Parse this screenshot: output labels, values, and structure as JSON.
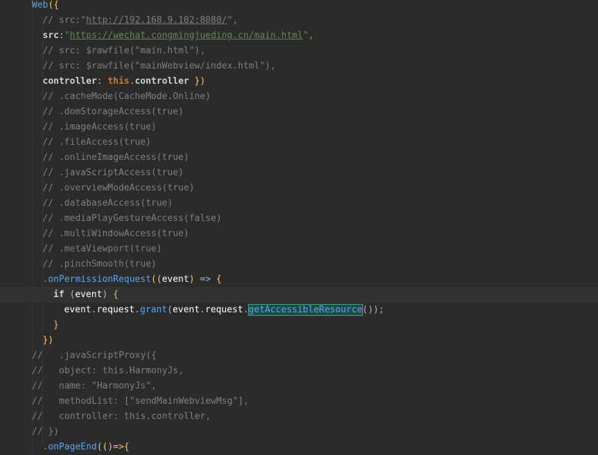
{
  "editor": {
    "lines": [
      {
        "indent": 0,
        "tokens": [
          {
            "t": "Web",
            "c": "f"
          },
          {
            "t": "({",
            "c": "y"
          }
        ]
      },
      {
        "indent": 1,
        "tokens": [
          {
            "t": "// src:\"",
            "c": "c"
          },
          {
            "t": "http://192.168.9.102:8080/",
            "c": "cu"
          },
          {
            "t": "\",",
            "c": "c"
          }
        ]
      },
      {
        "indent": 1,
        "tokens": [
          {
            "t": "src",
            "c": "w"
          },
          {
            "t": ":",
            "c": "p"
          },
          {
            "t": "\"",
            "c": "s"
          },
          {
            "t": "https://wechat.congmingjueding.cn/main.html",
            "c": "su"
          },
          {
            "t": "\"",
            "c": "s"
          },
          {
            "t": ",",
            "c": "k"
          }
        ]
      },
      {
        "indent": 1,
        "tokens": [
          {
            "t": "// src: $rawfile(\"main.html\"),",
            "c": "c"
          }
        ]
      },
      {
        "indent": 1,
        "tokens": [
          {
            "t": "// src: $rawfile(\"mainWebview/index.html\"),",
            "c": "c"
          }
        ]
      },
      {
        "indent": 1,
        "tokens": [
          {
            "t": "controller",
            "c": "w"
          },
          {
            "t": ": ",
            "c": "p"
          },
          {
            "t": "this",
            "c": "th"
          },
          {
            "t": ".",
            "c": "p"
          },
          {
            "t": "controller",
            "c": "w"
          },
          {
            "t": " })",
            "c": "y"
          }
        ]
      },
      {
        "indent": 1,
        "tokens": [
          {
            "t": "// .cacheMode(CacheMode.Online)",
            "c": "c"
          }
        ]
      },
      {
        "indent": 1,
        "tokens": [
          {
            "t": "// .domStorageAccess(true)",
            "c": "c"
          }
        ]
      },
      {
        "indent": 1,
        "tokens": [
          {
            "t": "// .imageAccess(true)",
            "c": "c"
          }
        ]
      },
      {
        "indent": 1,
        "tokens": [
          {
            "t": "// .fileAccess(true)",
            "c": "c"
          }
        ]
      },
      {
        "indent": 1,
        "tokens": [
          {
            "t": "// .onlineImageAccess(true)",
            "c": "c"
          }
        ]
      },
      {
        "indent": 1,
        "tokens": [
          {
            "t": "// .javaScriptAccess(true)",
            "c": "c"
          }
        ]
      },
      {
        "indent": 1,
        "tokens": [
          {
            "t": "// .overviewModeAccess(true)",
            "c": "c"
          }
        ]
      },
      {
        "indent": 1,
        "tokens": [
          {
            "t": "// .databaseAccess(true)",
            "c": "c"
          }
        ]
      },
      {
        "indent": 1,
        "tokens": [
          {
            "t": "// .mediaPlayGestureAccess(false)",
            "c": "c"
          }
        ]
      },
      {
        "indent": 1,
        "tokens": [
          {
            "t": "// .multiWindowAccess(true)",
            "c": "c"
          }
        ]
      },
      {
        "indent": 1,
        "tokens": [
          {
            "t": "// .metaViewport(true)",
            "c": "c"
          }
        ]
      },
      {
        "indent": 1,
        "tokens": [
          {
            "t": "// .pinchSmooth(true)",
            "c": "c"
          }
        ]
      },
      {
        "indent": 1,
        "tokens": [
          {
            "t": ".",
            "c": "k"
          },
          {
            "t": "onPermissionRequest",
            "c": "m"
          },
          {
            "t": "((",
            "c": "y"
          },
          {
            "t": "event",
            "c": "pl"
          },
          {
            "t": ") ",
            "c": "y"
          },
          {
            "t": "=> ",
            "c": "p"
          },
          {
            "t": "{",
            "c": "y"
          }
        ]
      },
      {
        "indent": 2,
        "current": true,
        "tokens": [
          {
            "t": "if",
            "c": "w"
          },
          {
            "t": " (",
            "c": "p"
          },
          {
            "t": "event",
            "c": "pl"
          },
          {
            "t": ") ",
            "c": "p"
          },
          {
            "t": "{",
            "c": "bk"
          }
        ]
      },
      {
        "indent": 3,
        "tokens": [
          {
            "t": "event",
            "c": "pl"
          },
          {
            "t": ".",
            "c": "p"
          },
          {
            "t": "request",
            "c": "pl"
          },
          {
            "t": ".",
            "c": "p"
          },
          {
            "t": "grant",
            "c": "m"
          },
          {
            "t": "(",
            "c": "p"
          },
          {
            "t": "event",
            "c": "pl"
          },
          {
            "t": ".",
            "c": "p"
          },
          {
            "t": "request",
            "c": "pl"
          },
          {
            "t": ".",
            "c": "p"
          },
          {
            "t": "getAccessibleResource",
            "c": "hl"
          },
          {
            "t": "());",
            "c": "p"
          }
        ]
      },
      {
        "indent": 2,
        "tokens": [
          {
            "t": "}",
            "c": "bk"
          }
        ]
      },
      {
        "indent": 1,
        "tokens": [
          {
            "t": "})",
            "c": "y"
          }
        ]
      },
      {
        "indent": 0,
        "tokens": [
          {
            "t": "//   .javaScriptProxy({",
            "c": "c"
          }
        ]
      },
      {
        "indent": 0,
        "tokens": [
          {
            "t": "//   object: this.HarmonyJs,",
            "c": "c"
          }
        ]
      },
      {
        "indent": 0,
        "tokens": [
          {
            "t": "//   name: \"HarmonyJs\",",
            "c": "c"
          }
        ]
      },
      {
        "indent": 0,
        "tokens": [
          {
            "t": "//   methodList: [\"sendMainWebviewMsg\"],",
            "c": "c"
          }
        ]
      },
      {
        "indent": 0,
        "tokens": [
          {
            "t": "//   controller: this.controller,",
            "c": "c"
          }
        ]
      },
      {
        "indent": 0,
        "tokens": [
          {
            "t": "// })",
            "c": "c"
          }
        ]
      },
      {
        "indent": 1,
        "tokens": [
          {
            "t": ".",
            "c": "k"
          },
          {
            "t": "onPageEnd",
            "c": "m"
          },
          {
            "t": "(()=>{",
            "c": "y"
          }
        ]
      }
    ]
  },
  "gutter": {
    "intention_icon": "lightbulb-icon",
    "icon_color": "#f2c94c"
  },
  "colors": {
    "background": "#2b2b2b",
    "current_line": "#323232",
    "comment": "#808080",
    "string": "#6a8759",
    "keyword": "#cc7832",
    "method": "#56a8f5"
  }
}
